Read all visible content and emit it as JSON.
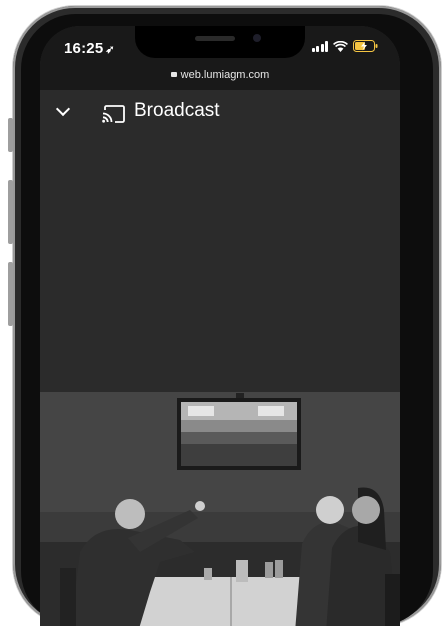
{
  "status_bar": {
    "time": "16:25",
    "location_glyph": "➶"
  },
  "browser": {
    "url": "web.lumiagm.com"
  },
  "app": {
    "title": "Broadcast"
  },
  "icons": [
    "chevron-down-icon",
    "cast-icon",
    "lock-icon",
    "signal-icon",
    "wifi-icon",
    "battery-charging-icon"
  ],
  "colors": {
    "background": "#2b2b2b",
    "browser_bar": "#191919",
    "header_text": "#ffffff"
  }
}
